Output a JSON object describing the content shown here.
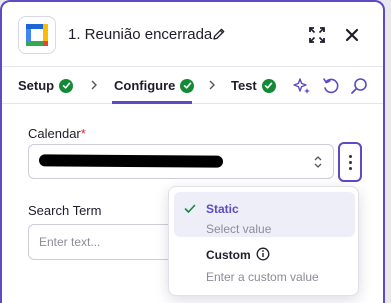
{
  "header": {
    "title": "1. Reunião encerrada"
  },
  "tabs": [
    {
      "label": "Setup"
    },
    {
      "label": "Configure"
    },
    {
      "label": "Test"
    }
  ],
  "form": {
    "calendar_label": "Calendar",
    "required_mark": "*",
    "search_term_label": "Search Term",
    "search_term_placeholder": "Enter text..."
  },
  "menu": {
    "static_title": "Static",
    "static_sub": "Select value",
    "custom_title": "Custom",
    "custom_sub": "Enter a custom value"
  },
  "colors": {
    "accent": "#5b4bc4",
    "success": "#138a36",
    "required": "#d0312d"
  }
}
